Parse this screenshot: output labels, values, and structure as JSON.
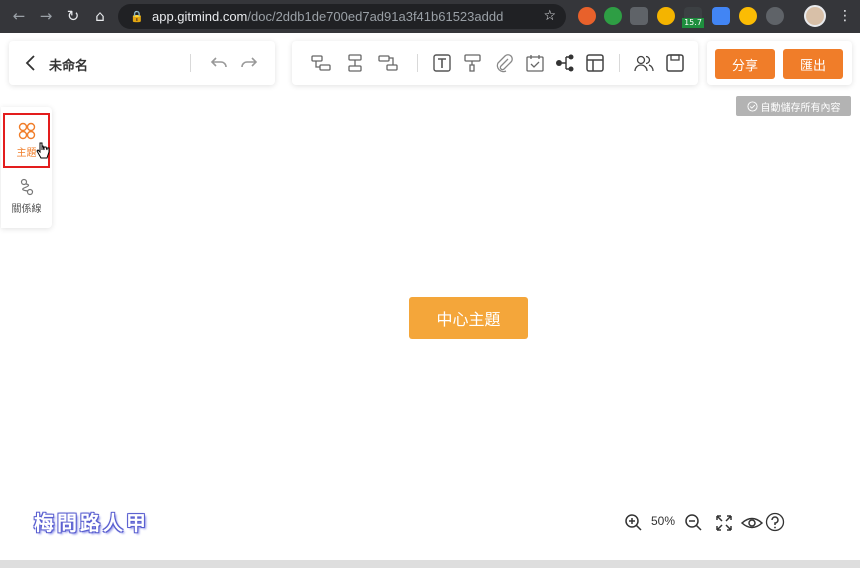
{
  "browser": {
    "url_host": "app.gitmind.com",
    "url_path": "/doc/2ddb1de700ed7ad91a3f41b61523addd",
    "extension_badge": "15.7"
  },
  "header": {
    "doc_title": "未命名",
    "share_label": "分享",
    "export_label": "匯出"
  },
  "toolbar": {
    "tools": [
      "sub-topic-icon",
      "sibling-topic-icon",
      "parent-topic-icon",
      "text-icon",
      "format-painter-icon",
      "attachment-icon",
      "task-icon",
      "structure-icon",
      "layout-icon",
      "collaborators-icon",
      "save-icon"
    ]
  },
  "autosave": {
    "text": "自動儲存所有內容"
  },
  "sidebar": {
    "items": [
      {
        "label": "主題"
      },
      {
        "label": "關係線"
      }
    ]
  },
  "canvas": {
    "center_topic": "中心主題"
  },
  "zoom": {
    "level": "50%"
  },
  "watermark": {
    "text": "梅問路人甲"
  },
  "colors": {
    "accent": "#f07d29",
    "topic": "#f4a63a",
    "highlight": "#e31d1d"
  }
}
